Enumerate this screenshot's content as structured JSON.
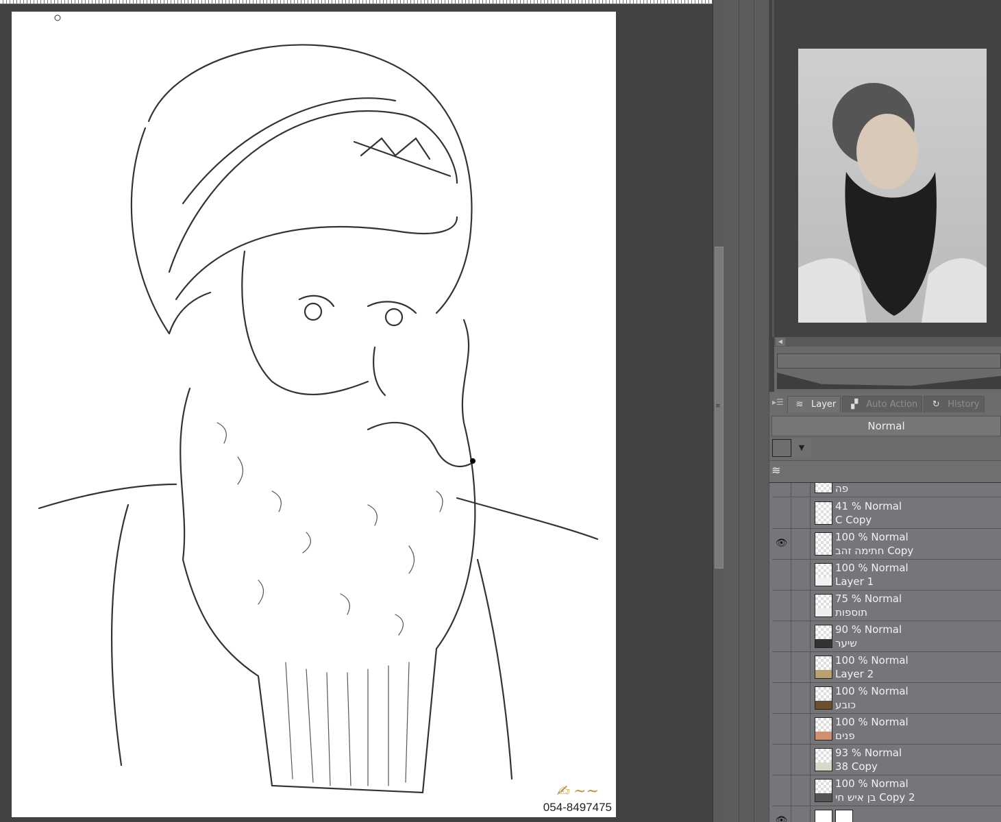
{
  "canvas": {
    "watermark_phone": "054-8497475",
    "watermark_logo": "בהיר בושארי"
  },
  "panel": {
    "tabs": [
      {
        "label": "Layer",
        "icon": "layers-icon"
      },
      {
        "label": "Auto Action",
        "icon": "clapper-icon"
      },
      {
        "label": "History",
        "icon": "history-icon"
      }
    ],
    "blend_mode": "Normal",
    "layers_partial_top": "פה",
    "layers": [
      {
        "opacity": "41 %",
        "mode": "Normal",
        "name": "C Copy",
        "visible": false
      },
      {
        "opacity": "100 %",
        "mode": "Normal",
        "name": "חתימה זהב Copy",
        "visible": true
      },
      {
        "opacity": "100 %",
        "mode": "Normal",
        "name": "Layer 1",
        "visible": false
      },
      {
        "opacity": "75 %",
        "mode": "Normal",
        "name": "תוספות",
        "visible": false
      },
      {
        "opacity": "90 %",
        "mode": "Normal",
        "name": "שיער",
        "visible": false
      },
      {
        "opacity": "100 %",
        "mode": "Normal",
        "name": "Layer 2",
        "visible": false
      },
      {
        "opacity": "100 %",
        "mode": "Normal",
        "name": "כובע",
        "visible": false
      },
      {
        "opacity": "100 %",
        "mode": "Normal",
        "name": "פנים",
        "visible": false
      },
      {
        "opacity": "93 %",
        "mode": "Normal",
        "name": "38 Copy",
        "visible": false
      },
      {
        "opacity": "100 %",
        "mode": "Normal",
        "name": "בן איש חי Copy 2",
        "visible": false
      }
    ]
  }
}
